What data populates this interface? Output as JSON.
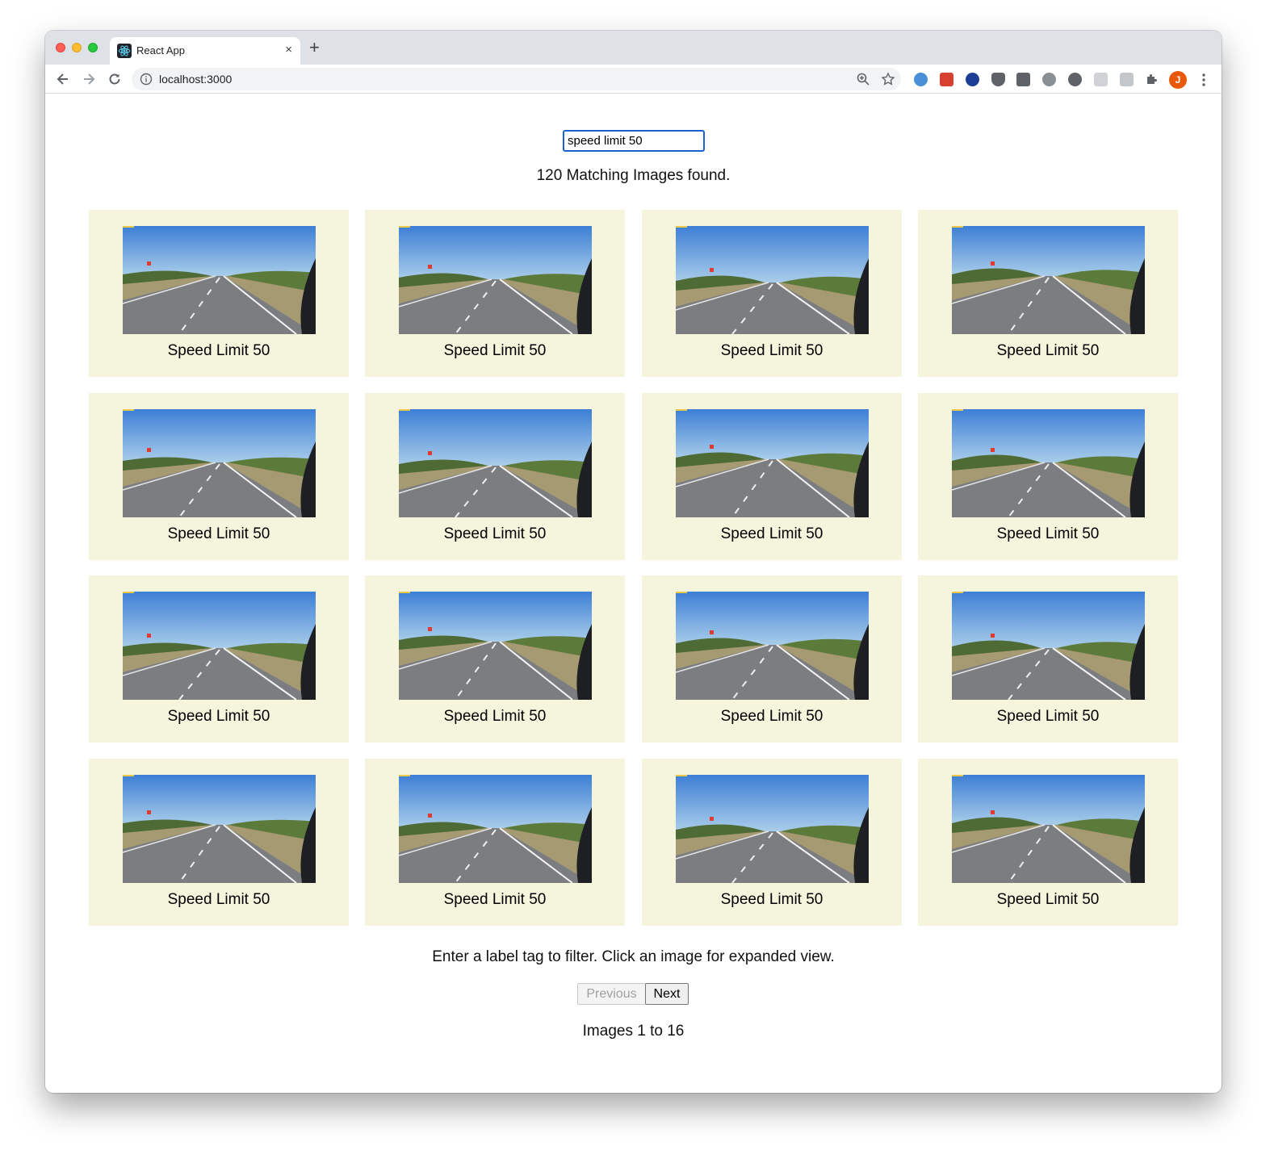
{
  "browser": {
    "tab_title": "React App",
    "tab_close": "×",
    "new_tab": "+",
    "url": "localhost:3000",
    "profile_initial": "J"
  },
  "search": {
    "value": "speed limit 50"
  },
  "results": {
    "count_text": "120 Matching Images found."
  },
  "images": [
    {
      "label": "Speed Limit 50"
    },
    {
      "label": "Speed Limit 50"
    },
    {
      "label": "Speed Limit 50"
    },
    {
      "label": "Speed Limit 50"
    },
    {
      "label": "Speed Limit 50"
    },
    {
      "label": "Speed Limit 50"
    },
    {
      "label": "Speed Limit 50"
    },
    {
      "label": "Speed Limit 50"
    },
    {
      "label": "Speed Limit 50"
    },
    {
      "label": "Speed Limit 50"
    },
    {
      "label": "Speed Limit 50"
    },
    {
      "label": "Speed Limit 50"
    },
    {
      "label": "Speed Limit 50"
    },
    {
      "label": "Speed Limit 50"
    },
    {
      "label": "Speed Limit 50"
    },
    {
      "label": "Speed Limit 50"
    }
  ],
  "footer": {
    "instructions": "Enter a label tag to filter. Click an image for expanded view.",
    "previous_label": "Previous",
    "next_label": "Next",
    "range_text": "Images 1 to 16"
  },
  "colors": {
    "card_background": "#f5f5de",
    "input_focus_border": "#1a5fd0",
    "profile_avatar": "#e8590c"
  }
}
